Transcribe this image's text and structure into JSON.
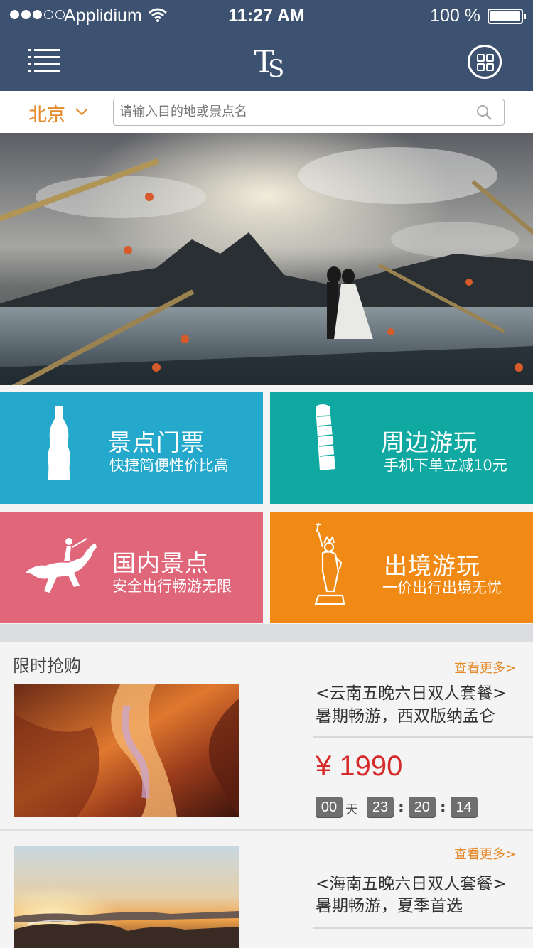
{
  "status_bar": {
    "carrier": "Applidium",
    "time": "11:27 AM",
    "battery": "100 %"
  },
  "header": {
    "logo_text": "TS",
    "menu_icon": "menu-list-icon",
    "grid_icon": "grid-circle-icon"
  },
  "search": {
    "city": "北京",
    "placeholder": "请输入目的地或景点名"
  },
  "categories": [
    {
      "title": "景点门票",
      "subtitle": "快捷简便性价比高",
      "color": "#24a9cc",
      "icon": "bottle-icon"
    },
    {
      "title": "周边游玩",
      "subtitle": "手机下单立减10元",
      "color": "#10a9a2",
      "icon": "leaning-tower-icon"
    },
    {
      "title": "国内景点",
      "subtitle": "安全出行畅游无限",
      "color": "#e0667a",
      "icon": "horse-rider-icon"
    },
    {
      "title": "出境游玩",
      "subtitle": "一价出行出境无忧",
      "color": "#f08a14",
      "icon": "statue-of-liberty-icon"
    }
  ],
  "flash_sale": {
    "section_title": "限时抢购",
    "more_label": "查看更多>",
    "deals": [
      {
        "title_line1": "<云南五晚六日双人套餐>",
        "title_line2": "暑期畅游，西双版纳孟仑",
        "price": "¥ 1990",
        "countdown": {
          "days": "00",
          "days_unit": "天",
          "hours": "23",
          "minutes": "20",
          "seconds": "14"
        }
      },
      {
        "title_line1": "<海南五晚六日双人套餐>",
        "title_line2": "暑期畅游，夏季首选"
      }
    ]
  }
}
